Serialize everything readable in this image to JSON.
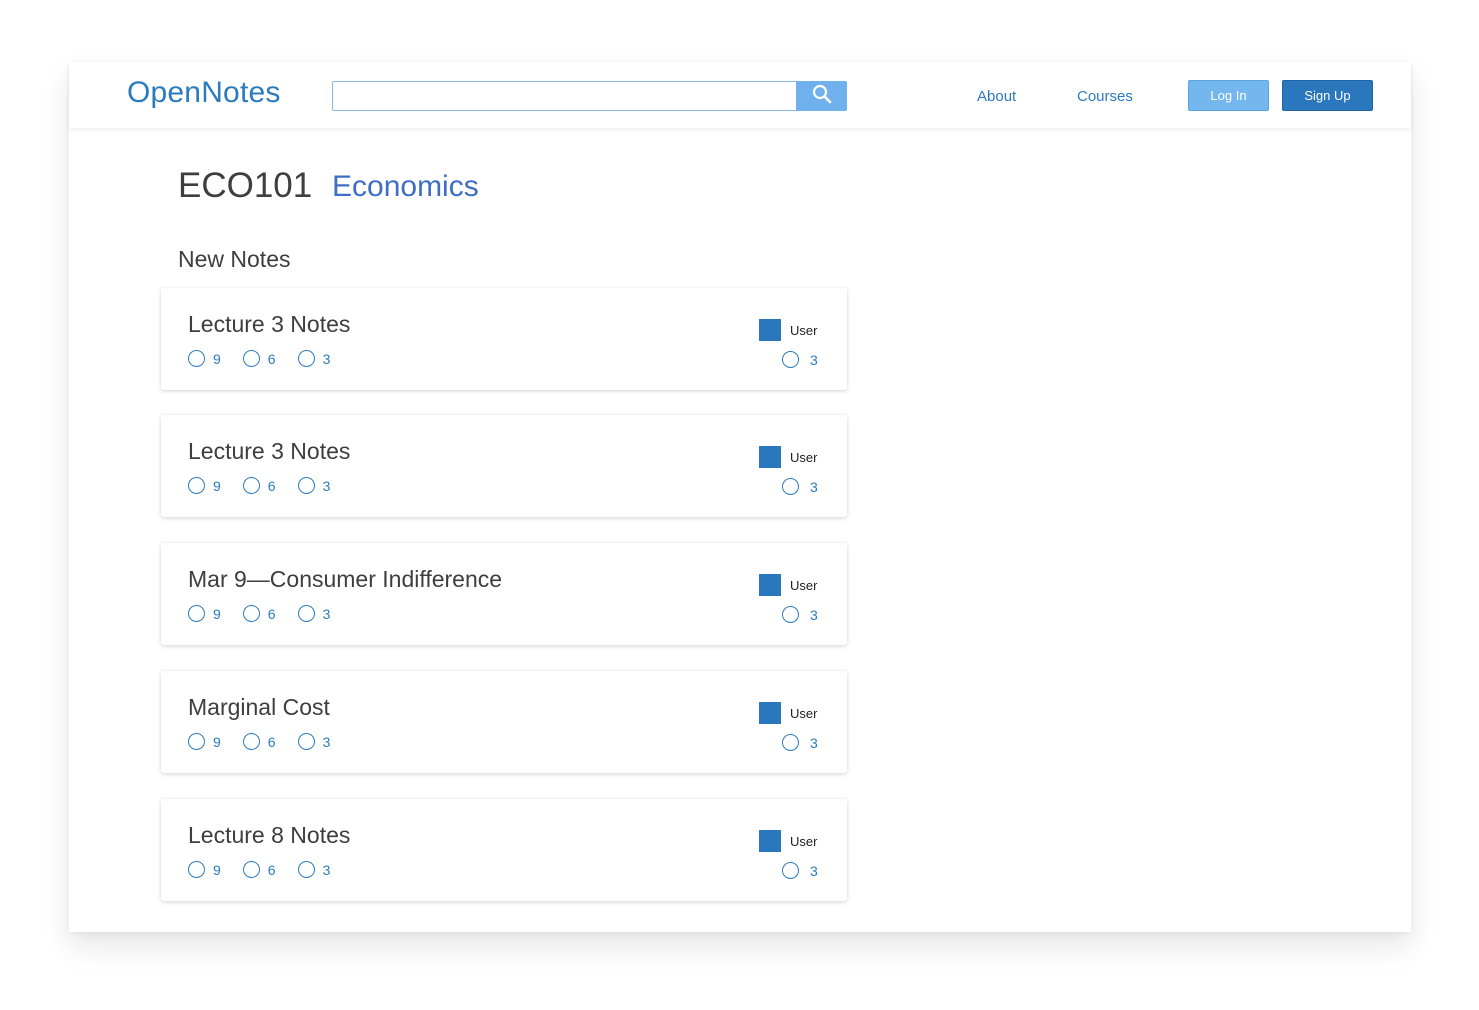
{
  "header": {
    "logo": "OpenNotes",
    "search": {
      "value": "",
      "placeholder": ""
    },
    "nav": {
      "about": "About",
      "courses": "Courses"
    },
    "login_label": "Log In",
    "signup_label": "Sign Up"
  },
  "course": {
    "code": "ECO101",
    "name": "Economics"
  },
  "section_title": "New Notes",
  "notes": [
    {
      "title": "Lecture 3 Notes",
      "stats": [
        "9",
        "6",
        "3"
      ],
      "user": "User",
      "user_stat": "3"
    },
    {
      "title": "Lecture 3 Notes",
      "stats": [
        "9",
        "6",
        "3"
      ],
      "user": "User",
      "user_stat": "3"
    },
    {
      "title": "Mar 9—Consumer Indifference",
      "stats": [
        "9",
        "6",
        "3"
      ],
      "user": "User",
      "user_stat": "3"
    },
    {
      "title": "Marginal Cost",
      "stats": [
        "9",
        "6",
        "3"
      ],
      "user": "User",
      "user_stat": "3"
    },
    {
      "title": "Lecture 8 Notes",
      "stats": [
        "9",
        "6",
        "3"
      ],
      "user": "User",
      "user_stat": "3"
    }
  ],
  "colors": {
    "primary": "#2a77bd",
    "link": "#2c7bbf",
    "accent_light": "#74b7ee",
    "course_name": "#3e6fc4",
    "text": "#3e3e42"
  },
  "icons": {
    "search": "search-icon",
    "stat": "circle-icon",
    "avatar": "avatar-square"
  }
}
